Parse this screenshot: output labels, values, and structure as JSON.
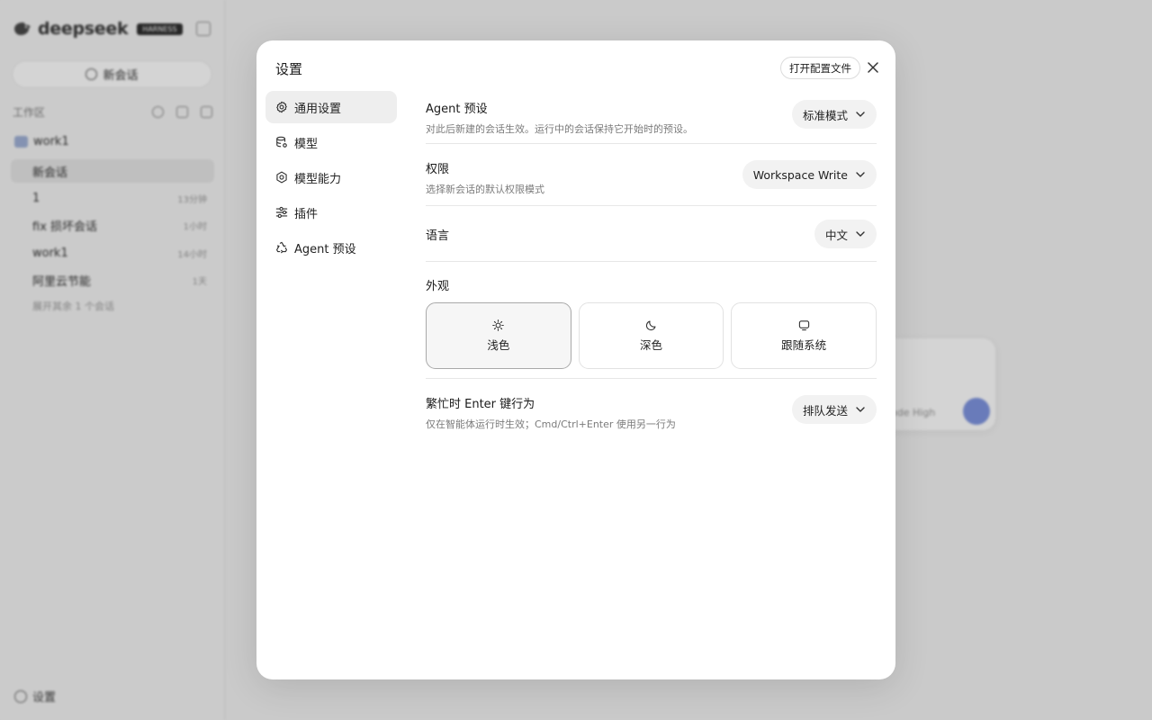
{
  "background": {
    "brand": {
      "name": "deepseek",
      "tag": "HARNESS"
    },
    "new_chat_label": "新会话",
    "workspace_label": "工作区",
    "folder_name": "work1",
    "chats": [
      {
        "title": "新会话",
        "time": "",
        "active": true
      },
      {
        "title": "1",
        "time": "13分钟",
        "active": false
      },
      {
        "title": "fix 损坏会话",
        "time": "1小时",
        "active": false
      },
      {
        "title": "work1",
        "time": "14小时",
        "active": false
      },
      {
        "title": "阿里云节能",
        "time": "1天",
        "active": false
      }
    ],
    "more_label": "展开其余 1 个会话",
    "settings_label": "设置",
    "composer_mode": "ode High"
  },
  "modal": {
    "title": "设置",
    "open_config_label": "打开配置文件",
    "nav": [
      {
        "label": "通用设置",
        "icon": "gear-icon",
        "active": true
      },
      {
        "label": "模型",
        "icon": "database-icon",
        "active": false
      },
      {
        "label": "模型能力",
        "icon": "hexagon-gear-icon",
        "active": false
      },
      {
        "label": "插件",
        "icon": "sliders-icon",
        "active": false
      },
      {
        "label": "Agent 预设",
        "icon": "recycle-icon",
        "active": false
      }
    ],
    "settings": {
      "agent_preset": {
        "title": "Agent 预设",
        "desc": "对此后新建的会话生效。运行中的会话保持它开始时的预设。",
        "value": "标准模式"
      },
      "permission": {
        "title": "权限",
        "desc": "选择新会话的默认权限模式",
        "value": "Workspace Write"
      },
      "language": {
        "title": "语言",
        "value": "中文"
      },
      "appearance": {
        "title": "外观",
        "options": [
          {
            "label": "浅色",
            "icon": "sun-icon",
            "selected": true
          },
          {
            "label": "深色",
            "icon": "moon-icon",
            "selected": false
          },
          {
            "label": "跟随系统",
            "icon": "monitor-icon",
            "selected": false
          }
        ]
      },
      "busy_enter": {
        "title": "繁忙时 Enter 键行为",
        "desc": "仅在智能体运行时生效；Cmd/Ctrl+Enter 使用另一行为",
        "value": "排队发送"
      }
    }
  }
}
